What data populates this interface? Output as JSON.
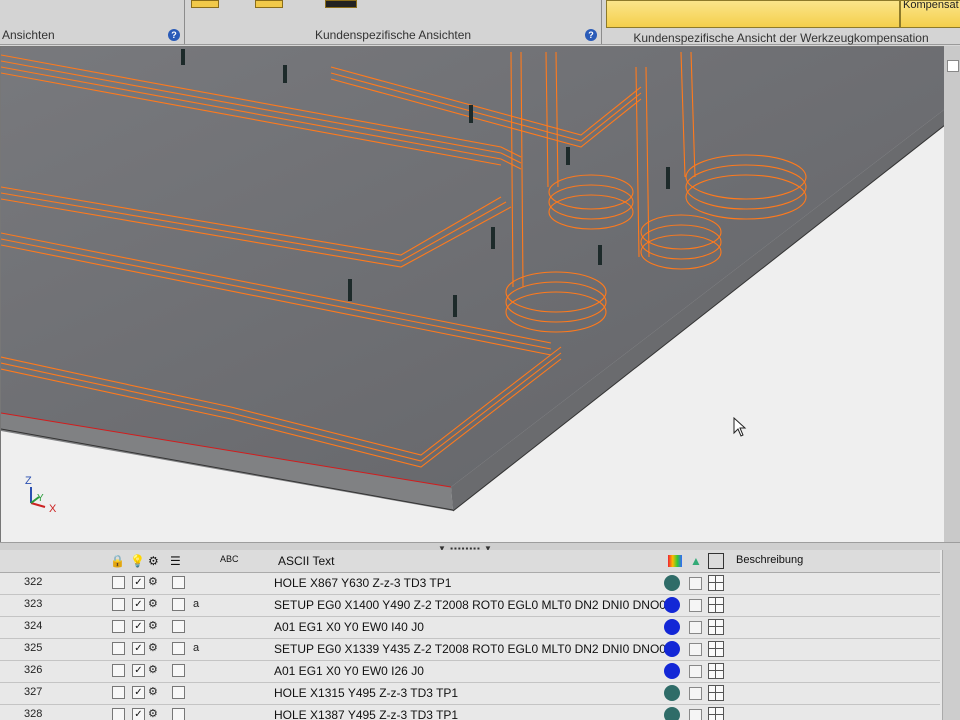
{
  "ribbon": {
    "groups": [
      {
        "label": "Ansichten"
      },
      {
        "label": "Kundenspezifische Ansichten"
      },
      {
        "label": "Kundenspezifische Ansicht der Werkzeugkompensation"
      }
    ],
    "yellow_button_label": "Kompensat"
  },
  "viewport": {
    "axis": {
      "z": "Z",
      "y": "Y",
      "x": "X"
    }
  },
  "grid": {
    "headers": {
      "flag_col": "ABC",
      "ascii": "ASCII Text",
      "desc": "Beschreibung"
    },
    "rows": [
      {
        "num": "322",
        "cb1": false,
        "cb2": true,
        "cb3": false,
        "flag": "",
        "text": "HOLE X867 Y630 Z-z-3 TD3 TP1",
        "dot": "#2f6c68"
      },
      {
        "num": "323",
        "cb1": false,
        "cb2": true,
        "cb3": false,
        "flag": "a",
        "text": "SETUP EG0 X1400 Y490 Z-2 T2008 ROT0 EGL0 MLT0 DN2 DNI0 DNO0 ...",
        "dot": "#1327d6"
      },
      {
        "num": "324",
        "cb1": false,
        "cb2": true,
        "cb3": false,
        "flag": "",
        "text": "A01 EG1 X0 Y0 EW0 I40 J0",
        "dot": "#1327d6"
      },
      {
        "num": "325",
        "cb1": false,
        "cb2": true,
        "cb3": false,
        "flag": "a",
        "text": "SETUP EG0 X1339 Y435 Z-2 T2008 ROT0 EGL0 MLT0 DN2 DNI0 DNO0 ...",
        "dot": "#1327d6"
      },
      {
        "num": "326",
        "cb1": false,
        "cb2": true,
        "cb3": false,
        "flag": "",
        "text": "A01 EG1 X0 Y0 EW0 I26 J0",
        "dot": "#1327d6"
      },
      {
        "num": "327",
        "cb1": false,
        "cb2": true,
        "cb3": false,
        "flag": "",
        "text": "HOLE X1315 Y495 Z-z-3 TD3 TP1",
        "dot": "#2f6c68"
      },
      {
        "num": "328",
        "cb1": false,
        "cb2": true,
        "cb3": false,
        "flag": "",
        "text": "HOLE X1387 Y495 Z-z-3 TD3 TP1",
        "dot": "#2f6c68"
      }
    ]
  }
}
